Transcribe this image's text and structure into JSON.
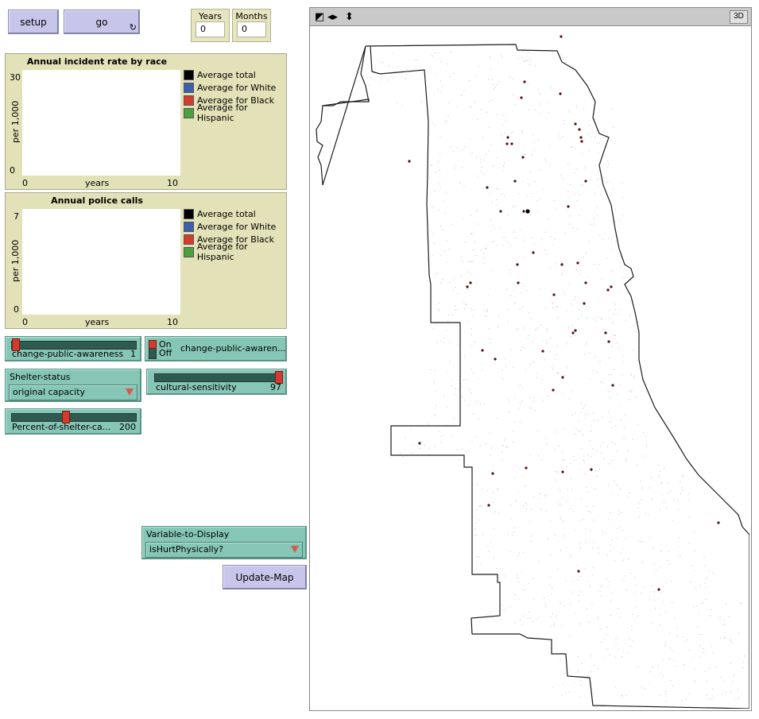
{
  "buttons": {
    "setup": "setup",
    "go": "go",
    "go_icon": "↻",
    "update_map": "Update-Map"
  },
  "monitors": [
    {
      "label": "Years",
      "value": "0"
    },
    {
      "label": "Months",
      "value": "0"
    }
  ],
  "plots": [
    {
      "title": "Annual incident rate by race",
      "ylabel": "per 1,000",
      "xlabel": "years",
      "ymax_label": "30",
      "ymin_label": "0",
      "xmin_label": "0",
      "xmax_label": "10"
    },
    {
      "title": "Annual police calls",
      "ylabel": "per 1,000",
      "xlabel": "years",
      "ymax_label": "7",
      "ymin_label": "0",
      "xmin_label": "0",
      "xmax_label": "10"
    }
  ],
  "legend": [
    {
      "label": "Average total",
      "color": "#000000"
    },
    {
      "label": "Average for White",
      "color": "#3b5fad"
    },
    {
      "label": "Average for Black",
      "color": "#d33b2f"
    },
    {
      "label": "Average for Hispanic",
      "color": "#4aa340"
    }
  ],
  "sliders": {
    "awareness": {
      "label": "change-public-awareness",
      "value": "1",
      "level": 0.0
    },
    "cultural": {
      "label": "cultural-sensitivity",
      "value": "97",
      "level": 1.0
    },
    "shelter_cap": {
      "label": "Percent-of-shelter-ca...",
      "value": "200",
      "level": 0.4
    }
  },
  "switch": {
    "on": "On",
    "off": "Off",
    "label": "change-public-awaren..."
  },
  "choosers": {
    "shelter_status": {
      "label": "Shelter-status",
      "value": "original capacity"
    },
    "variable": {
      "label": "Variable-to-Display",
      "value": "isHurtPhysically?"
    }
  },
  "view": {
    "button_3d": "3D"
  },
  "colors": {
    "button": "#c7c6ea",
    "monitor": "#e6e5c0",
    "plot": "#e2e1b7",
    "widget": "#86c6b6",
    "incident_marker": "#5a0a0a",
    "population_dots": "#a9bde0"
  }
}
